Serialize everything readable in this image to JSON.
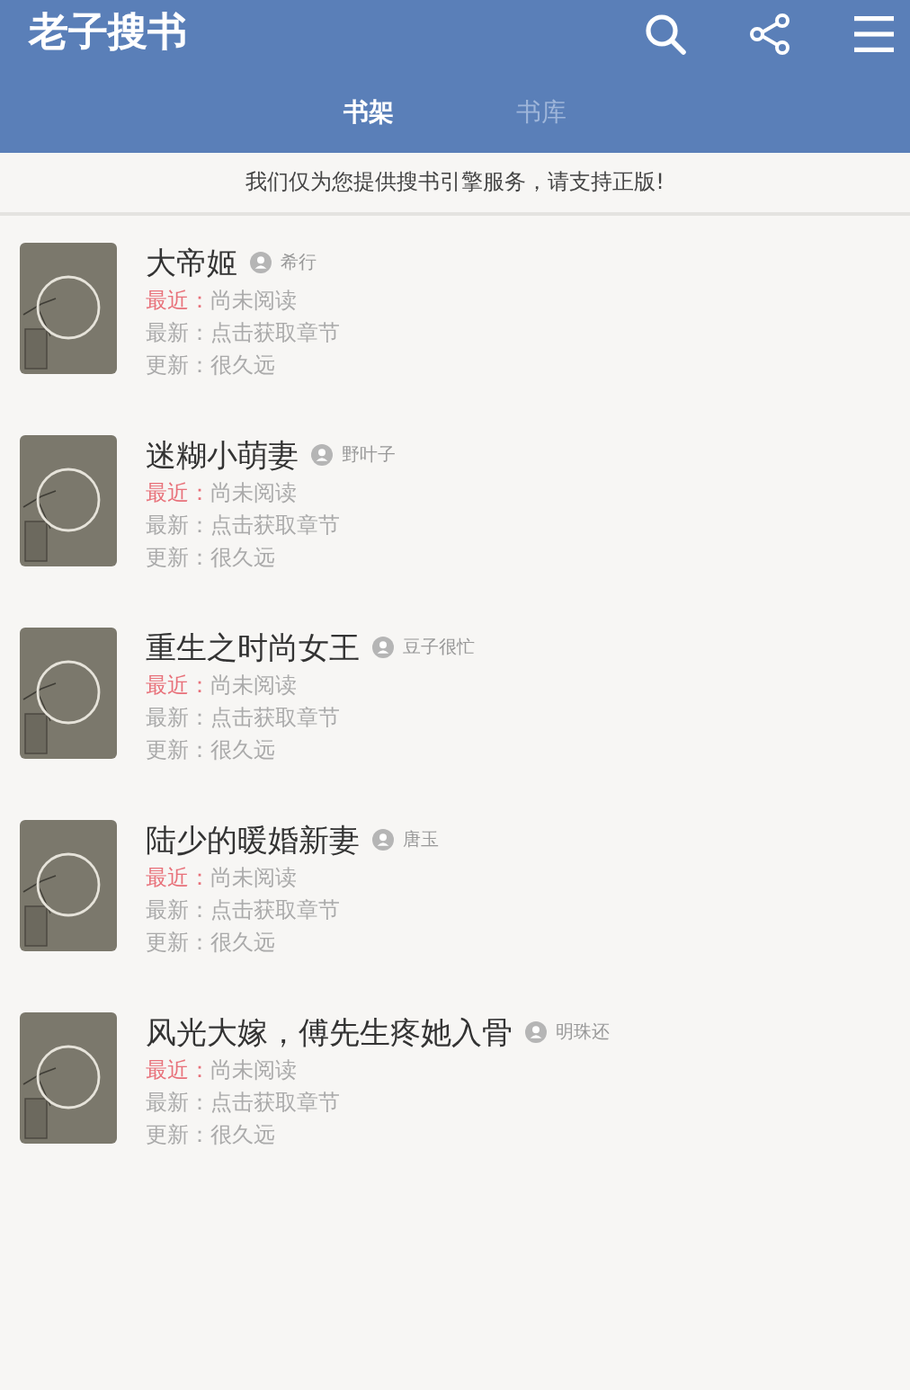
{
  "app_bar": {
    "title": "老子搜书"
  },
  "tabs": [
    {
      "label": "书架",
      "selected": true
    },
    {
      "label": "书库",
      "selected": false
    }
  ],
  "notice": "我们仅为您提供搜书引擎服务，请支持正版!",
  "books": [
    {
      "title": "大帝姬",
      "author": "希行",
      "lines": [
        {
          "label": "最近：",
          "value": "尚未阅读",
          "highlight": true
        },
        {
          "label": "最新：",
          "value": "点击获取章节",
          "highlight": false
        },
        {
          "label": "更新：",
          "value": "很久远",
          "highlight": false
        }
      ]
    },
    {
      "title": "迷糊小萌妻",
      "author": "野叶子",
      "lines": [
        {
          "label": "最近：",
          "value": "尚未阅读",
          "highlight": true
        },
        {
          "label": "最新：",
          "value": "点击获取章节",
          "highlight": false
        },
        {
          "label": "更新：",
          "value": "很久远",
          "highlight": false
        }
      ]
    },
    {
      "title": "重生之时尚女王",
      "author": "豆子很忙",
      "lines": [
        {
          "label": "最近：",
          "value": "尚未阅读",
          "highlight": true
        },
        {
          "label": "最新：",
          "value": "点击获取章节",
          "highlight": false
        },
        {
          "label": "更新：",
          "value": "很久远",
          "highlight": false
        }
      ]
    },
    {
      "title": "陆少的暖婚新妻",
      "author": "唐玉",
      "lines": [
        {
          "label": "最近：",
          "value": "尚未阅读",
          "highlight": true
        },
        {
          "label": "最新：",
          "value": "点击获取章节",
          "highlight": false
        },
        {
          "label": "更新：",
          "value": "很久远",
          "highlight": false
        }
      ]
    },
    {
      "title": "风光大嫁，傅先生疼她入骨",
      "author": "明珠还",
      "lines": [
        {
          "label": "最近：",
          "value": "尚未阅读",
          "highlight": true
        },
        {
          "label": "最新：",
          "value": "点击获取章节",
          "highlight": false
        },
        {
          "label": "更新：",
          "value": "很久远",
          "highlight": false
        }
      ]
    }
  ]
}
